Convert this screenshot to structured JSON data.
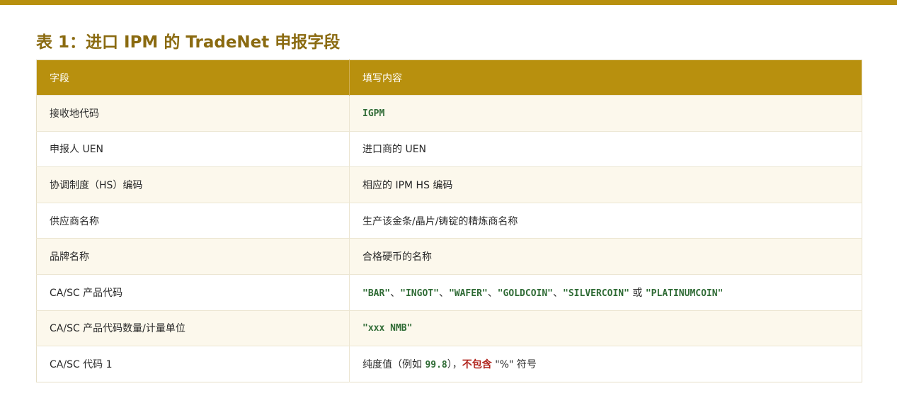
{
  "title": "表 1：进口 IPM 的 TradeNet 申报字段",
  "table": {
    "headers": [
      "字段",
      "填写内容"
    ],
    "rows": [
      {
        "field": "接收地代码",
        "code": "IGPM"
      },
      {
        "field": "申报人 UEN",
        "value": "进口商的 UEN"
      },
      {
        "field": "协调制度（HS）编码",
        "value": "相应的 IPM HS 编码"
      },
      {
        "field": "供应商名称",
        "value": "生产该金条/晶片/铸锭的精炼商名称"
      },
      {
        "field": "品牌名称",
        "value": "合格硬币的名称"
      },
      {
        "field": "CA/SC 产品代码",
        "codes": [
          "\"BAR\"",
          "\"INGOT\"",
          "\"WAFER\"",
          "\"GOLDCOIN\"",
          "\"SILVERCOIN\"",
          "\"PLATINUMCOIN\""
        ],
        "separator": "、",
        "or_word": "或"
      },
      {
        "field": "CA/SC 产品代码数量/计量单位",
        "code": "\"xxx NMB\""
      },
      {
        "field": "CA/SC 代码 1",
        "prefix": "纯度值（例如",
        "code": "99.8",
        "middle": "），",
        "warning": "不包含",
        "suffix": "\"%\" 符号"
      }
    ]
  },
  "colors": {
    "accent": "#b8900e",
    "title": "#8a6a10",
    "code": "#2f6b35",
    "warning": "#b0231c",
    "row_alt": "#fcf8ec"
  }
}
